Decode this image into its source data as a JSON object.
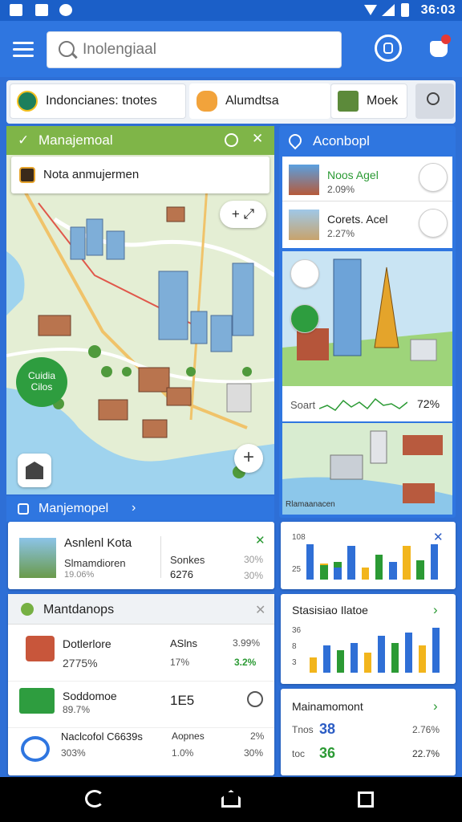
{
  "status": {
    "time": "36:03"
  },
  "search": {
    "placeholder": "Inolengiaal"
  },
  "tabs": [
    {
      "label": "Indoncianes: tnotes"
    },
    {
      "label": "Alumdtsa"
    },
    {
      "label": "Moek"
    }
  ],
  "map_panel": {
    "title": "Manajemoal",
    "search_label": "Nota anmujermen",
    "zoom_label": "+ ⤢",
    "badge_label": "Cuidia Cilos",
    "footer_title": "Manjemopel"
  },
  "right_panel": {
    "title": "Aconbopl",
    "items": [
      {
        "title": "Noos Agel",
        "value": "2.09%"
      },
      {
        "title": "Corets. Acel",
        "value": "2.27%"
      }
    ],
    "stat_label": "Soart",
    "stat_value": "72%",
    "caption": "Rlamaanacen"
  },
  "card_kota": {
    "title": "Asnlenl Kota",
    "sub1": "Slmamdioren",
    "sub2": "19.06%",
    "col_title": "Sonkes",
    "col_value": "6276",
    "p1": "30%",
    "p2": "30%"
  },
  "mini_chart": {
    "ticks": [
      "108",
      "25"
    ]
  },
  "list_panel": {
    "title": "Mantdanops",
    "rows": [
      {
        "name": "Dotlerlore",
        "sub": "2775%",
        "col1": "ASlns",
        "col1b": "17%",
        "col2": "3.99%",
        "col2b": "3.2%"
      },
      {
        "name": "Soddomoe",
        "sub": "89.7%",
        "col1": "1E5",
        "col1b": "",
        "col2": "",
        "col2b": ""
      },
      {
        "name": "Naclcofol C6639s",
        "sub": "303%",
        "col1": "Aopnes",
        "col1b": "1.0%",
        "col2": "2%",
        "col2b": "30%"
      }
    ]
  },
  "stats_card": {
    "title": "Stasisiao Ilatoe",
    "ticks": [
      "36",
      "8",
      "3"
    ]
  },
  "summary_card": {
    "title": "Mainamomont",
    "r1_label": "Tnos",
    "r1_value": "38",
    "r1_pct": "2.76%",
    "r2_label": "toc",
    "r2_value": "36",
    "r2_pct": "22.7%"
  },
  "colors": {
    "primary": "#2f76e0",
    "green": "#76b043",
    "accent_green": "#2b9a34",
    "bar_blue": "#2f6fd6",
    "bar_yellow": "#f2b51c"
  },
  "chart_data": [
    {
      "type": "bar",
      "series": [
        {
          "values": [
            1.0,
            0.45,
            0.5,
            0.95,
            0.35,
            0.7,
            0.5,
            0.95,
            0.55,
            1.0
          ]
        },
        {
          "values": [
            0,
            0.4,
            0.35,
            0,
            0,
            0,
            0,
            0,
            0,
            0
          ]
        }
      ],
      "categories": [
        "1",
        "2",
        "3",
        "4",
        "5",
        "6",
        "7",
        "8",
        "9",
        "10"
      ]
    },
    {
      "type": "bar",
      "series": [
        {
          "values": [
            0.3,
            0.55,
            0.45,
            0.6,
            0.4,
            0.75,
            0.6,
            0.8,
            0.55,
            0.9
          ]
        }
      ],
      "categories": [
        "1",
        "2",
        "3",
        "4",
        "5",
        "6",
        "7",
        "8",
        "9",
        "10"
      ]
    }
  ]
}
